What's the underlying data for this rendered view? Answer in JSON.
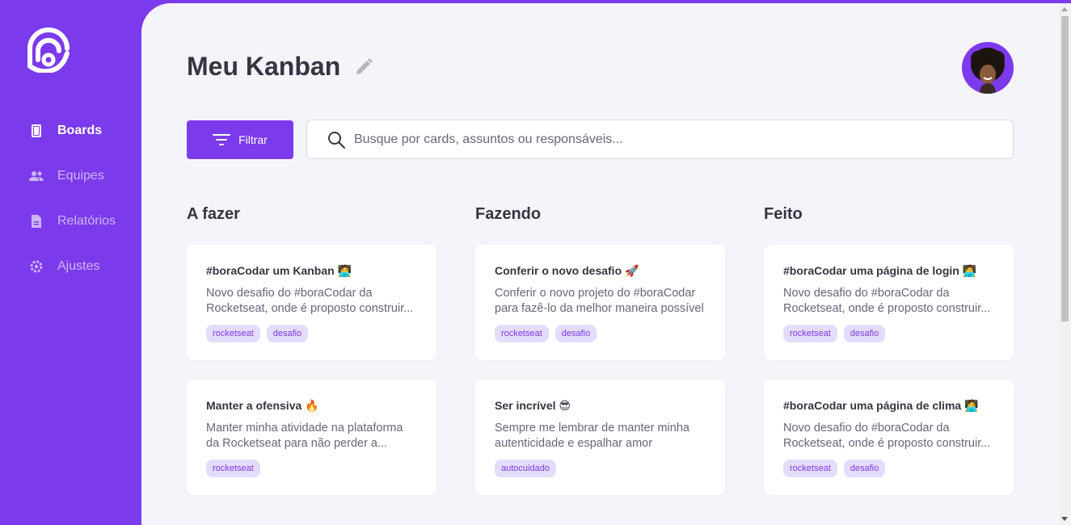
{
  "sidebar": {
    "items": [
      {
        "label": "Boards",
        "icon": "board-icon",
        "active": true
      },
      {
        "label": "Equipes",
        "icon": "team-icon"
      },
      {
        "label": "Relatórios",
        "icon": "report-icon"
      },
      {
        "label": "Ajustes",
        "icon": "settings-icon"
      }
    ]
  },
  "header": {
    "title": "Meu Kanban"
  },
  "toolbar": {
    "filter_label": "Filtrar",
    "search_placeholder": "Busque por cards, assuntos ou responsáveis..."
  },
  "colors": {
    "accent": "#7c3aed",
    "background": "#f6f4fb",
    "tag_bg": "#e4dcfa"
  },
  "columns": [
    {
      "title": "A fazer",
      "cards": [
        {
          "title": "#boraCodar um Kanban 🧑‍💻",
          "desc": "Novo desafio do #boraCodar da Rocketseat, onde é proposto construir...",
          "tags": [
            "rocketseat",
            "desafio"
          ]
        },
        {
          "title": "Manter a ofensiva 🔥",
          "desc": "Manter minha atividade na plataforma da Rocketseat para não perder a...",
          "tags": [
            "rocketseat"
          ]
        }
      ]
    },
    {
      "title": "Fazendo",
      "cards": [
        {
          "title": "Conferir o novo desafio 🚀",
          "desc": "Conferir o novo projeto do #boraCodar para fazê-lo da melhor maneira possível",
          "tags": [
            "rocketseat",
            "desafio"
          ]
        },
        {
          "title": "Ser incrível 😎",
          "desc": "Sempre me lembrar de manter minha autenticidade e espalhar amor",
          "tags": [
            "autocuidado"
          ]
        }
      ]
    },
    {
      "title": "Feito",
      "cards": [
        {
          "title": "#boraCodar uma página de login 🧑‍💻",
          "desc": "Novo desafio do #boraCodar da Rocketseat, onde é proposto construir...",
          "tags": [
            "rocketseat",
            "desafio"
          ]
        },
        {
          "title": "#boraCodar uma página de clima 🧑‍💻",
          "desc": "Novo desafio do #boraCodar da Rocketseat, onde é proposto construir...",
          "tags": [
            "rocketseat",
            "desafio"
          ]
        }
      ]
    }
  ]
}
